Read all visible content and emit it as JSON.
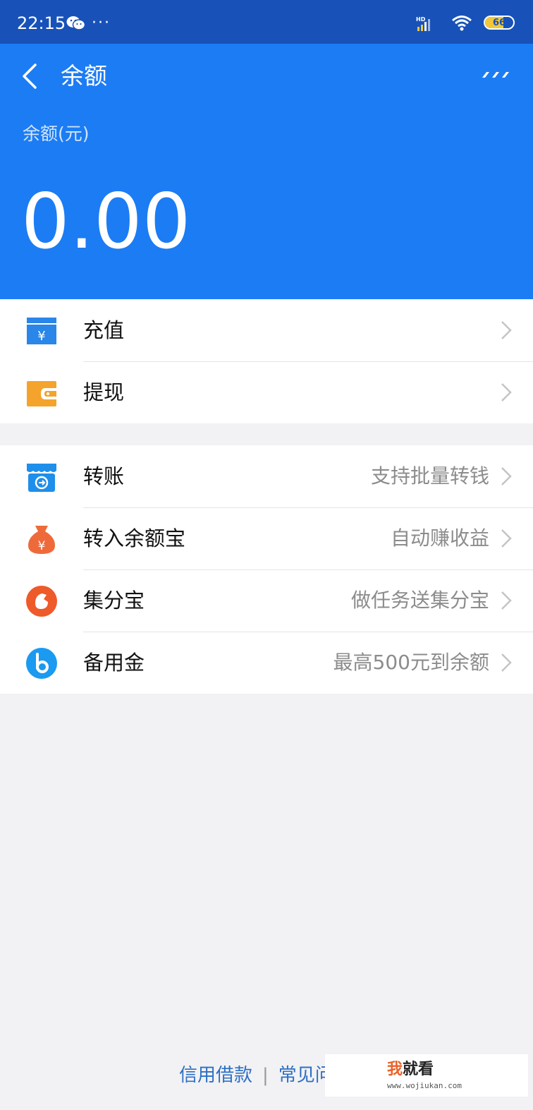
{
  "status_bar": {
    "time": "22:15",
    "more": "···",
    "hd": "HD",
    "battery_text": "66",
    "battery_level": 0.66
  },
  "header": {
    "title": "余额",
    "balance_label": "余额(元)",
    "balance_amount": "0.00"
  },
  "group1": [
    {
      "label": "充值",
      "hint": "",
      "icon": "recharge-icon"
    },
    {
      "label": "提现",
      "hint": "",
      "icon": "withdraw-wallet-icon"
    }
  ],
  "group2": [
    {
      "label": "转账",
      "hint": "支持批量转钱",
      "icon": "transfer-store-icon"
    },
    {
      "label": "转入余额宝",
      "hint": "自动赚收益",
      "icon": "money-bag-icon"
    },
    {
      "label": "集分宝",
      "hint": "做任务送集分宝",
      "icon": "jifenbao-icon"
    },
    {
      "label": "备用金",
      "hint": "最高500元到余额",
      "icon": "reserve-fund-icon"
    }
  ],
  "footer": {
    "link1": "信用借款",
    "separator": "|",
    "link2": "常见问"
  },
  "watermark": {
    "title_a": "我",
    "title_b": "就看",
    "sub": "www.wojiukan.com"
  },
  "colors": {
    "status_bar": "#1852b8",
    "header": "#1c7cf4",
    "link": "#2d6fc4",
    "hint": "#8c8c8c"
  }
}
